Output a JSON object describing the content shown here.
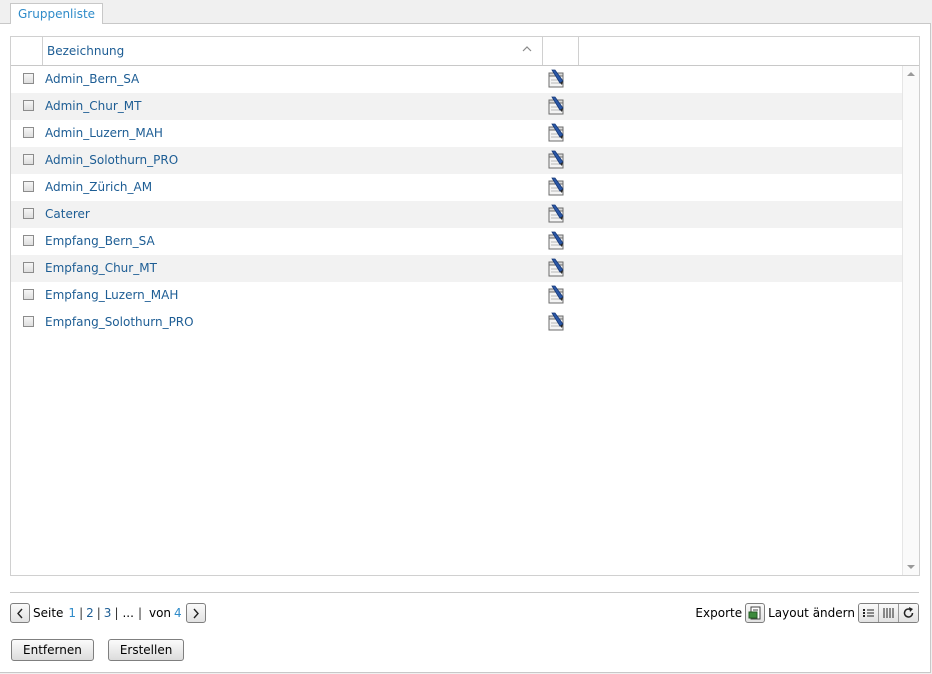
{
  "tab": {
    "label": "Gruppenliste"
  },
  "grid": {
    "columns": {
      "name": "Bezeichnung"
    },
    "rows": [
      {
        "name": "Admin_Bern_SA"
      },
      {
        "name": "Admin_Chur_MT"
      },
      {
        "name": "Admin_Luzern_MAH"
      },
      {
        "name": "Admin_Solothurn_PRO"
      },
      {
        "name": "Admin_Zürich_AM"
      },
      {
        "name": "Caterer"
      },
      {
        "name": "Empfang_Bern_SA"
      },
      {
        "name": "Empfang_Chur_MT"
      },
      {
        "name": "Empfang_Luzern_MAH"
      },
      {
        "name": "Empfang_Solothurn_PRO"
      }
    ]
  },
  "pager": {
    "seite_label": "Seite",
    "pages": [
      "1",
      "2",
      "3"
    ],
    "ellipsis": "...",
    "von_label": "von",
    "total": "4",
    "current": "1"
  },
  "tools": {
    "export_label": "Exporte",
    "layout_label": "Layout ändern"
  },
  "actions": {
    "remove_label": "Entfernen",
    "create_label": "Erstellen"
  },
  "colors": {
    "link": "#1d5d94",
    "accent": "#2e8bc9",
    "row_alt": "#f2f2f2"
  },
  "icons": [
    "sort-ascending-icon",
    "edit-note-icon",
    "chevron-left-icon",
    "chevron-right-icon",
    "export-icon",
    "list-layout-icon",
    "column-layout-icon",
    "refresh-icon"
  ]
}
